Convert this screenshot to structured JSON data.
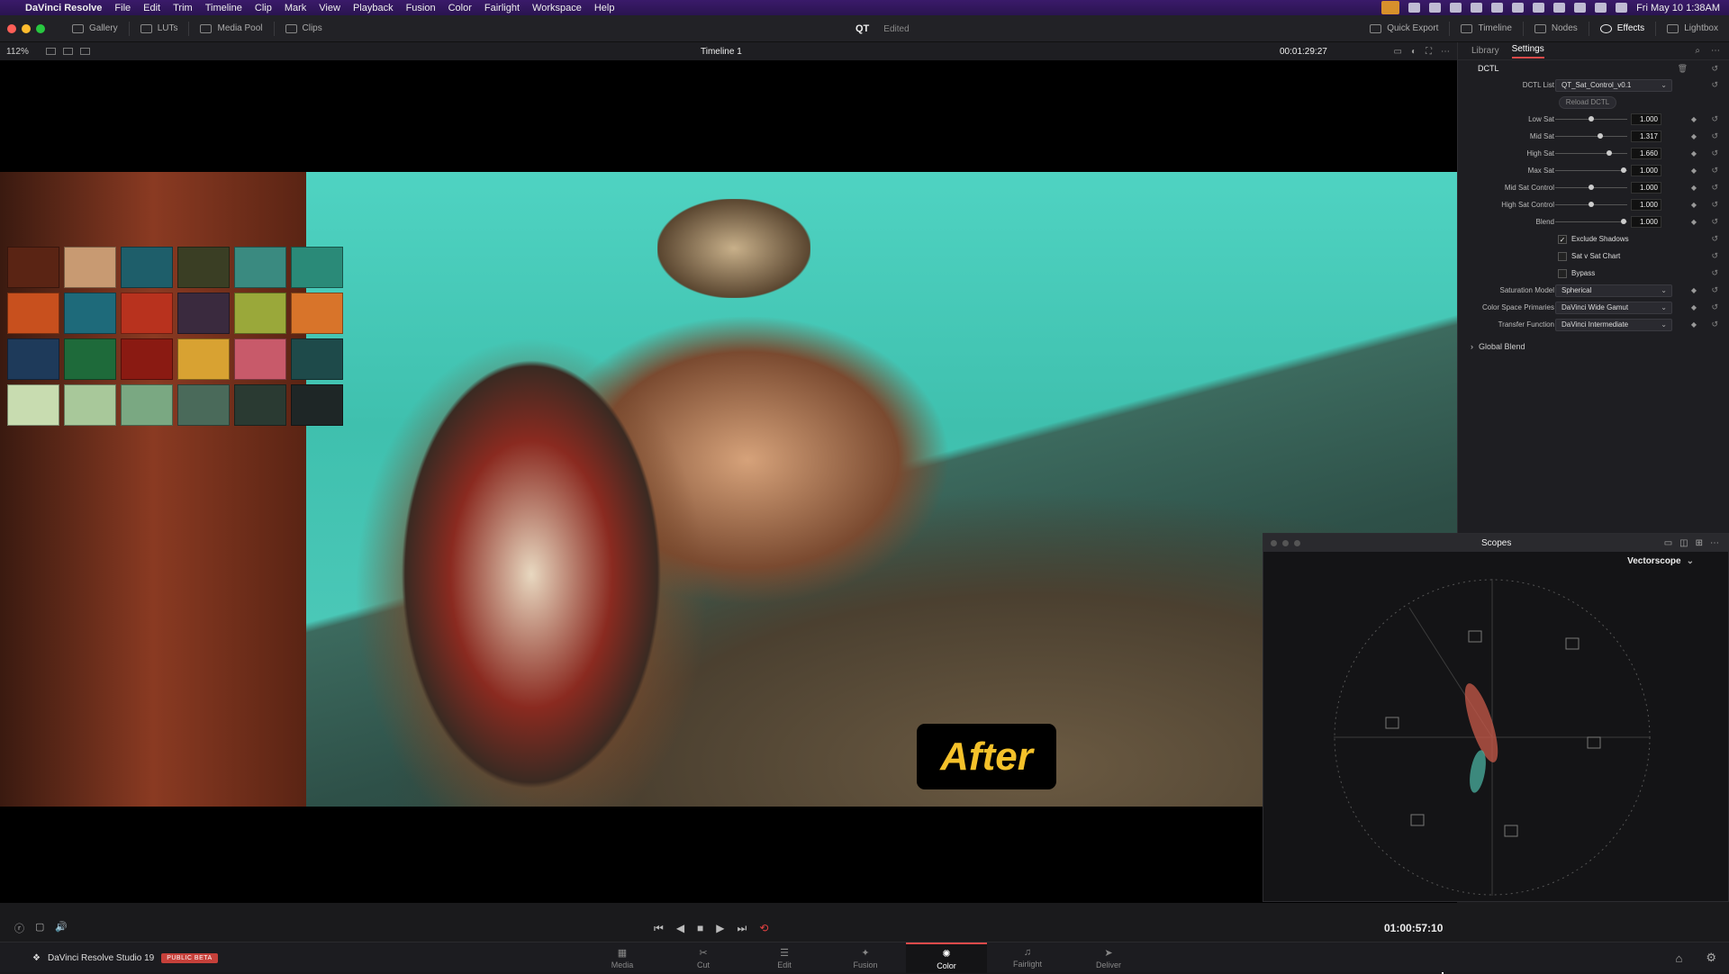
{
  "menubar": {
    "app_name": "DaVinci Resolve",
    "items": [
      "File",
      "Edit",
      "Trim",
      "Timeline",
      "Clip",
      "Mark",
      "View",
      "Playback",
      "Fusion",
      "Color",
      "Fairlight",
      "Workspace",
      "Help"
    ],
    "clock": "Fri May 10  1:38AM"
  },
  "toolbar": {
    "left": [
      "Gallery",
      "LUTs",
      "Media Pool",
      "Clips"
    ],
    "project": "QT",
    "status": "Edited",
    "right": [
      "Quick Export",
      "Timeline",
      "Nodes",
      "Effects",
      "Lightbox"
    ]
  },
  "viewer": {
    "zoom": "112%",
    "timeline_name": "Timeline 1",
    "timecode": "00:01:29:27",
    "badge": "After",
    "swatch_colors": [
      "#5a2414",
      "#c89a72",
      "#1e5e6a",
      "#3a3e24",
      "#3a8a80",
      "#2a8a78",
      "#c8501e",
      "#1e6a7a",
      "#b8321e",
      "#3a2a3e",
      "#9aa83a",
      "#d8742a",
      "#1e3a5a",
      "#1e6a3a",
      "#8a1a12",
      "#d8a232",
      "#c85a6a",
      "#1e4a4a",
      "#c8dcb0",
      "#a8c89a",
      "#7aa882",
      "#4a6a5a",
      "#2a3a32",
      "#1e2626"
    ],
    "playback_timecode": "01:00:57:10"
  },
  "panel": {
    "tabs": [
      "Library",
      "Settings"
    ],
    "active_tab": "Settings",
    "effect_name": "DCTL",
    "dctl_list_label": "DCTL List",
    "dctl_list_value": "QT_Sat_Control_v0.1",
    "reload_label": "Reload DCTL",
    "sliders": [
      {
        "label": "Low Sat",
        "value": "1.000",
        "frac": 0.5
      },
      {
        "label": "Mid Sat",
        "value": "1.317",
        "frac": 0.62
      },
      {
        "label": "High Sat",
        "value": "1.660",
        "frac": 0.75
      },
      {
        "label": "Max Sat",
        "value": "1.000",
        "frac": 0.95
      },
      {
        "label": "Mid Sat Control",
        "value": "1.000",
        "frac": 0.5
      },
      {
        "label": "High Sat Control",
        "value": "1.000",
        "frac": 0.5
      },
      {
        "label": "Blend",
        "value": "1.000",
        "frac": 0.95
      }
    ],
    "checkboxes": [
      {
        "label": "Exclude Shadows",
        "checked": true
      },
      {
        "label": "Sat v Sat Chart",
        "checked": false
      },
      {
        "label": "Bypass",
        "checked": false
      }
    ],
    "selects": [
      {
        "label": "Saturation Model",
        "value": "Spherical"
      },
      {
        "label": "Color Space Primaries",
        "value": "DaVinci Wide Gamut"
      },
      {
        "label": "Transfer Function",
        "value": "DaVinci Intermediate"
      }
    ],
    "global_blend": "Global Blend"
  },
  "scopes": {
    "title": "Scopes",
    "mode": "Vectorscope"
  },
  "bottom": {
    "brand": "DaVinci Resolve Studio 19",
    "beta": "PUBLIC BETA",
    "pages": [
      "Media",
      "Cut",
      "Edit",
      "Fusion",
      "Color",
      "Fairlight",
      "Deliver"
    ],
    "active_page": "Color"
  }
}
